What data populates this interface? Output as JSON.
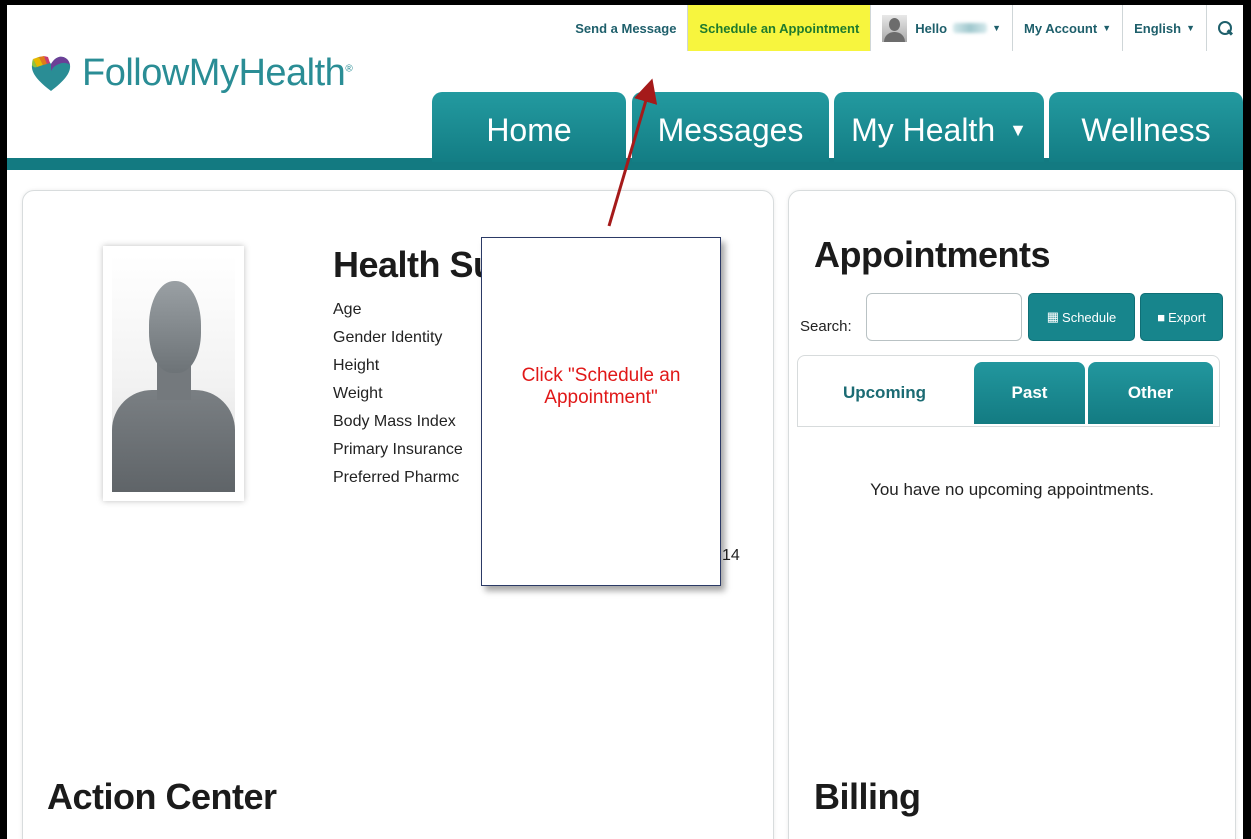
{
  "utility_bar": {
    "send_message": "Send a Message",
    "schedule_appointment": "Schedule an Appointment",
    "hello": "Hello",
    "my_account": "My Account",
    "language": "English",
    "caret": "▼"
  },
  "brand": {
    "name": "FollowMyHealth",
    "mark": "®",
    "color": "#2a8d95"
  },
  "nav": {
    "tabs": [
      {
        "label": "Home"
      },
      {
        "label": "Messages"
      },
      {
        "label": "My Health"
      },
      {
        "label": "Wellness"
      }
    ],
    "caret": "▼"
  },
  "health_summary": {
    "title": "Health Su",
    "rows": [
      "Age",
      "Gender Identity",
      "Height",
      "Weight",
      "Body Mass Index",
      "Primary Insurance",
      "Preferred Pharmc"
    ],
    "pharmacy_value_tail": "14"
  },
  "callout": {
    "text": "Click \"Schedule an Appointment\""
  },
  "appointments": {
    "title": "Appointments",
    "search_label": "Search:",
    "search_value": "",
    "schedule_button": "Schedule",
    "export_button": "Export",
    "tabs": [
      "Upcoming",
      "Past",
      "Other"
    ],
    "empty_message": "You have no upcoming appointments."
  },
  "action_center": {
    "title": "Action Center"
  },
  "billing": {
    "title": "Billing"
  },
  "colors": {
    "teal": "#137a81",
    "highlight": "#f7f53e",
    "callout_text": "#e01818",
    "arrow": "#a51a1a"
  }
}
